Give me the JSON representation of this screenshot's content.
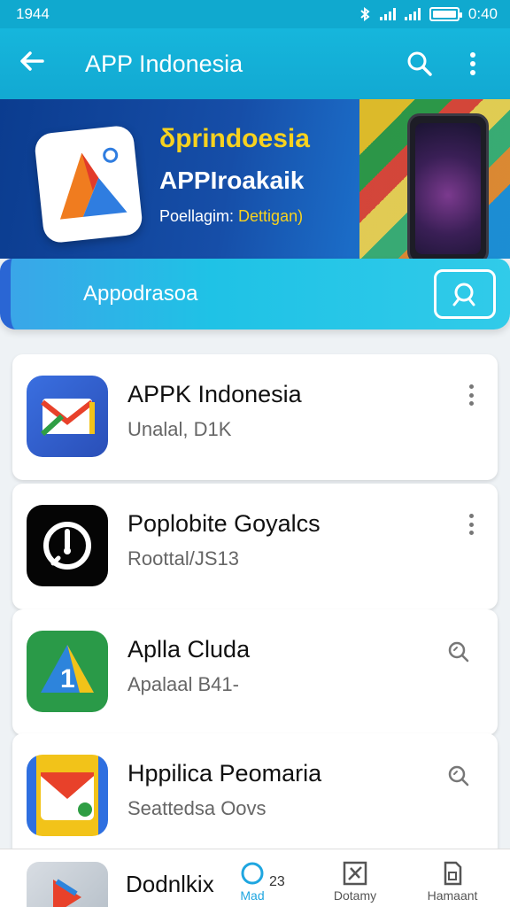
{
  "status_bar": {
    "time_left": "1944",
    "time_right": "0:40"
  },
  "app_bar": {
    "title": "APP Indonesia"
  },
  "banner": {
    "line1": "δprindoesia",
    "line2": "APPIroakaik",
    "line3_a": "Poellagim: ",
    "line3_b": "Dettigan)"
  },
  "search": {
    "label": "Appodrasoa"
  },
  "apps": [
    {
      "name": "APPK Indonesia",
      "sub": "Unalal, D1K",
      "action": "more-vert"
    },
    {
      "name": "Poplobite Goyalcs",
      "sub": "Roottal/JS13",
      "action": "more-vert"
    },
    {
      "name": "Aplla Cluda",
      "sub": "Apalaal B41-",
      "action": "zoom"
    },
    {
      "name": "Hppilica Peomaria",
      "sub": "Seattedsa Oovs",
      "action": "zoom"
    }
  ],
  "bottom_nav": {
    "partial_app_name": "Dodnlkix",
    "items": [
      {
        "label": "Mad",
        "badge": "23",
        "icon": "circle-icon"
      },
      {
        "label": "Dotamy",
        "icon": "tools-icon"
      },
      {
        "label": "Hamaant",
        "icon": "document-icon"
      }
    ]
  },
  "colors": {
    "app_bar": "#12a9d2",
    "accent": "#1fa6e0",
    "banner_dark": "#0b3c8f",
    "banner_yellow": "#f7d21f"
  }
}
